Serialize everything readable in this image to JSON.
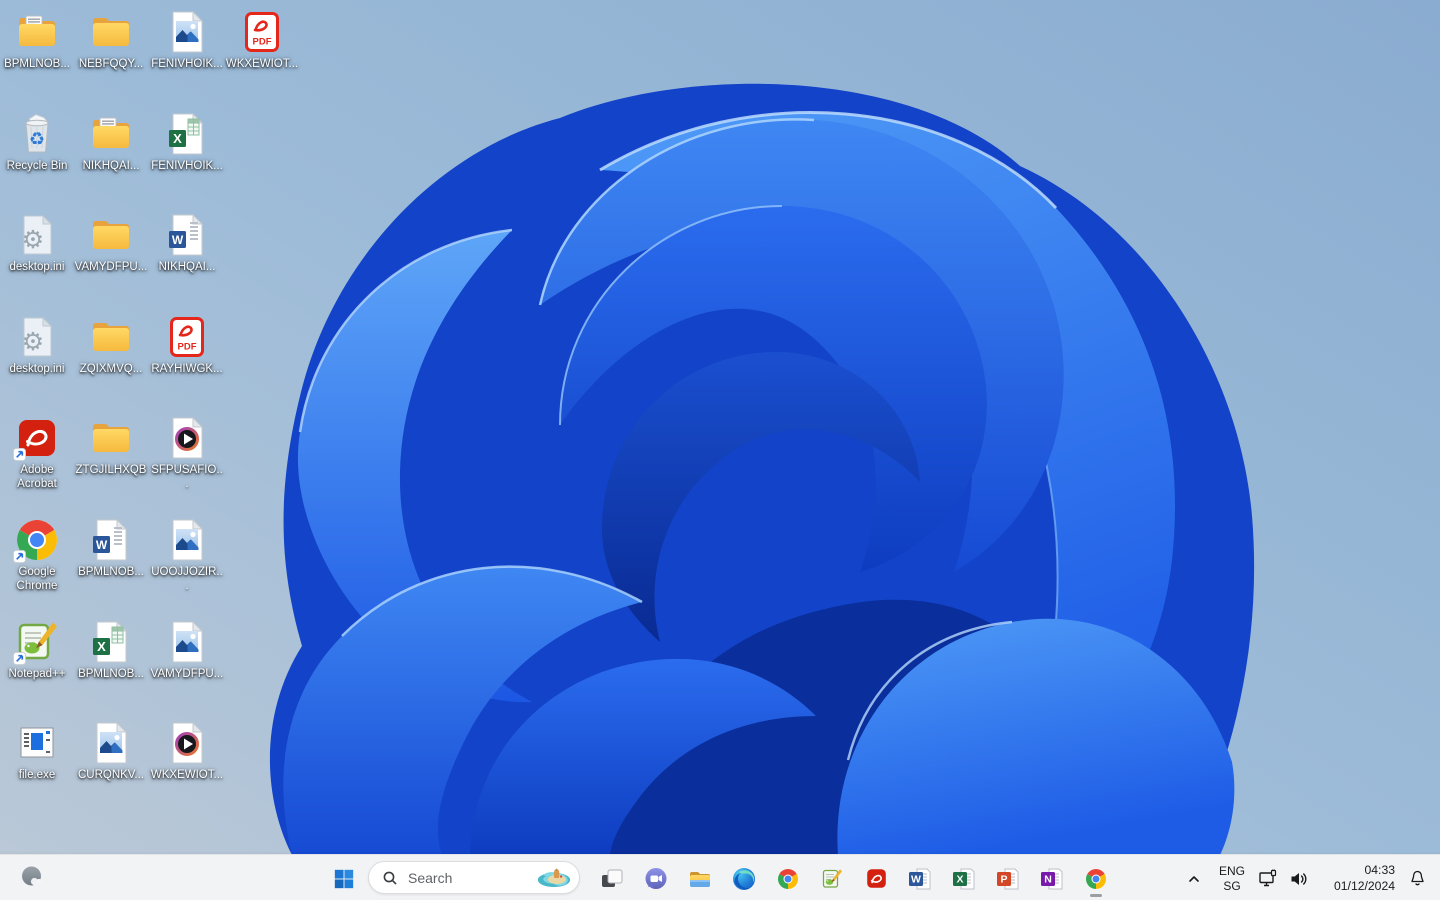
{
  "desktop": {
    "icons": [
      {
        "label": "BPMLNOB...",
        "type": "folder-docs",
        "col": 1,
        "row": 1
      },
      {
        "label": "NEBFQQY...",
        "type": "folder",
        "col": 2,
        "row": 1
      },
      {
        "label": "FENIVHOIK...",
        "type": "image",
        "col": 3,
        "row": 1
      },
      {
        "label": "WKXEWIOT...",
        "type": "pdf",
        "col": 4,
        "row": 1
      },
      {
        "label": "Recycle Bin",
        "type": "recycle-bin",
        "col": 1,
        "row": 2
      },
      {
        "label": "NIKHQAI...",
        "type": "folder-docs",
        "col": 2,
        "row": 2
      },
      {
        "label": "FENIVHOIK...",
        "type": "excel",
        "col": 3,
        "row": 2
      },
      {
        "label": "desktop.ini",
        "type": "ini",
        "col": 1,
        "row": 3
      },
      {
        "label": "VAMYDFPU...",
        "type": "folder",
        "col": 2,
        "row": 3
      },
      {
        "label": "NIKHQAI...",
        "type": "word",
        "col": 3,
        "row": 3
      },
      {
        "label": "desktop.ini",
        "type": "ini",
        "col": 1,
        "row": 4
      },
      {
        "label": "ZQIXMVQ...",
        "type": "folder",
        "col": 2,
        "row": 4
      },
      {
        "label": "RAYHIWGK...",
        "type": "pdf",
        "col": 3,
        "row": 4
      },
      {
        "label": "Adobe Acrobat",
        "type": "acrobat",
        "col": 1,
        "row": 5,
        "shortcut": true
      },
      {
        "label": "ZTGJILHXQB",
        "type": "folder",
        "col": 2,
        "row": 5
      },
      {
        "label": "SFPUSAFIO...",
        "type": "media",
        "col": 3,
        "row": 5
      },
      {
        "label": "Google Chrome",
        "type": "chrome",
        "col": 1,
        "row": 6,
        "shortcut": true
      },
      {
        "label": "BPMLNOB...",
        "type": "word",
        "col": 2,
        "row": 6
      },
      {
        "label": "UOOJJOZIR...",
        "type": "image",
        "col": 3,
        "row": 6
      },
      {
        "label": "Notepad++",
        "type": "npp",
        "col": 1,
        "row": 7,
        "shortcut": true
      },
      {
        "label": "BPMLNOB...",
        "type": "excel",
        "col": 2,
        "row": 7
      },
      {
        "label": "VAMYDFPU...",
        "type": "image",
        "col": 3,
        "row": 7
      },
      {
        "label": "file.exe",
        "type": "exe",
        "col": 1,
        "row": 8
      },
      {
        "label": "CURQNKV...",
        "type": "image",
        "col": 2,
        "row": 8
      },
      {
        "label": "WKXEWIOT...",
        "type": "media",
        "col": 3,
        "row": 8
      }
    ]
  },
  "taskbar": {
    "search": {
      "placeholder": "Search"
    },
    "apps": [
      {
        "name": "task-view",
        "type": "taskview"
      },
      {
        "name": "chat",
        "type": "chat"
      },
      {
        "name": "file-explorer",
        "type": "explorer"
      },
      {
        "name": "edge",
        "type": "edge"
      },
      {
        "name": "chrome",
        "type": "chrome"
      },
      {
        "name": "notepad-plus-plus",
        "type": "npp"
      },
      {
        "name": "acrobat",
        "type": "acrobat"
      },
      {
        "name": "word",
        "type": "office",
        "letter": "W",
        "color": "#2b579a"
      },
      {
        "name": "excel",
        "type": "office",
        "letter": "X",
        "color": "#1e7145"
      },
      {
        "name": "powerpoint",
        "type": "office",
        "letter": "P",
        "color": "#d24726"
      },
      {
        "name": "onenote",
        "type": "office",
        "letter": "N",
        "color": "#7719aa"
      },
      {
        "name": "chrome-active",
        "type": "chrome",
        "active": true
      }
    ],
    "tray": {
      "language_top": "ENG",
      "language_bottom": "SG",
      "time": "04:33",
      "date": "01/12/2024"
    }
  },
  "colors": {
    "taskbar_bg": "#f2f3f5",
    "start_blue": "#1b77d3",
    "bloom_deep": "#0a2e9c",
    "bloom_bright": "#2f7ff4",
    "desktop_sky_right": "#8aacd0",
    "desktop_sky_left": "#bac8d7"
  }
}
